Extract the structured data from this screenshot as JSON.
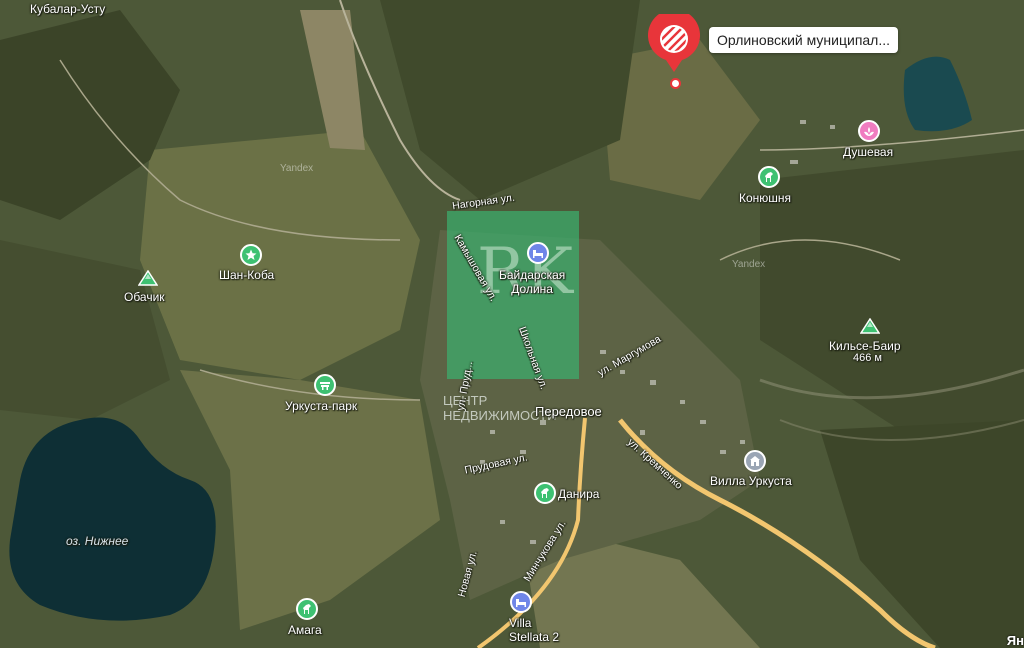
{
  "map": {
    "places": {
      "kubalar_ustu": "Кубалар-Усту",
      "shan_koba": "Шан-Коба",
      "obachik": "Обачик",
      "urkusta_park": "Уркуста-парк",
      "baydarskaya_dolina": "Байдарская\nДолина",
      "peredovoe": "Передовое",
      "konyushnya": "Конюшня",
      "dushevaya": "Душевая",
      "kilse_bair": "Кильсе-Баир",
      "kilse_bair_elev": "466 м",
      "villa_urkusta": "Вилла Уркуста",
      "danira": "Данира",
      "amaga": "Амага",
      "villa_stellata": "Villa\nStellata 2",
      "lake": "оз. Нижнее"
    },
    "streets": {
      "nagornaya": "Нагорная ул.",
      "kamyshovaya": "Камышовая ул.",
      "shkolnaya": "Школьная ул.",
      "ul_ptu": "ул. Пруд...",
      "margumova": "ул. Маргумова",
      "kremchenko": "ул. Кремченко",
      "prudovaya": "Прудовая ул.",
      "minchukova": "Минчукова ул.",
      "novaya": "Новая ул."
    },
    "watermarks": [
      "Yandex",
      "Yandex"
    ],
    "colors": {
      "pin": "#e8353a",
      "poi_recreation": "#3ec172",
      "poi_hotel": "#6f86e8",
      "poi_spa": "#f07cc0",
      "poi_villa": "#9aa5b4",
      "road": "#f2c66f",
      "water": "#0e2f35",
      "watermark": "#3caf6e"
    },
    "icons": {
      "pin": "striped-pin-icon",
      "shan_koba": "star-icon",
      "obachik": "mountain-icon",
      "kilse_bair": "mountain-icon",
      "urkusta_park": "park-icon",
      "baydarskaya_dolina": "bed-icon",
      "konyushnya": "horse-icon",
      "danira": "horse-icon",
      "amaga": "horse-icon",
      "dushevaya": "spa-icon",
      "villa_urkusta": "villa-icon",
      "villa_stellata": "bed-icon"
    }
  },
  "selected": {
    "label": "Орлиновский муниципал..."
  },
  "watermark_overlay": {
    "logo": "RK",
    "text": "ЦЕНТР\nНЕДВИЖИМОСТИ"
  },
  "corner_logo": "Ян"
}
